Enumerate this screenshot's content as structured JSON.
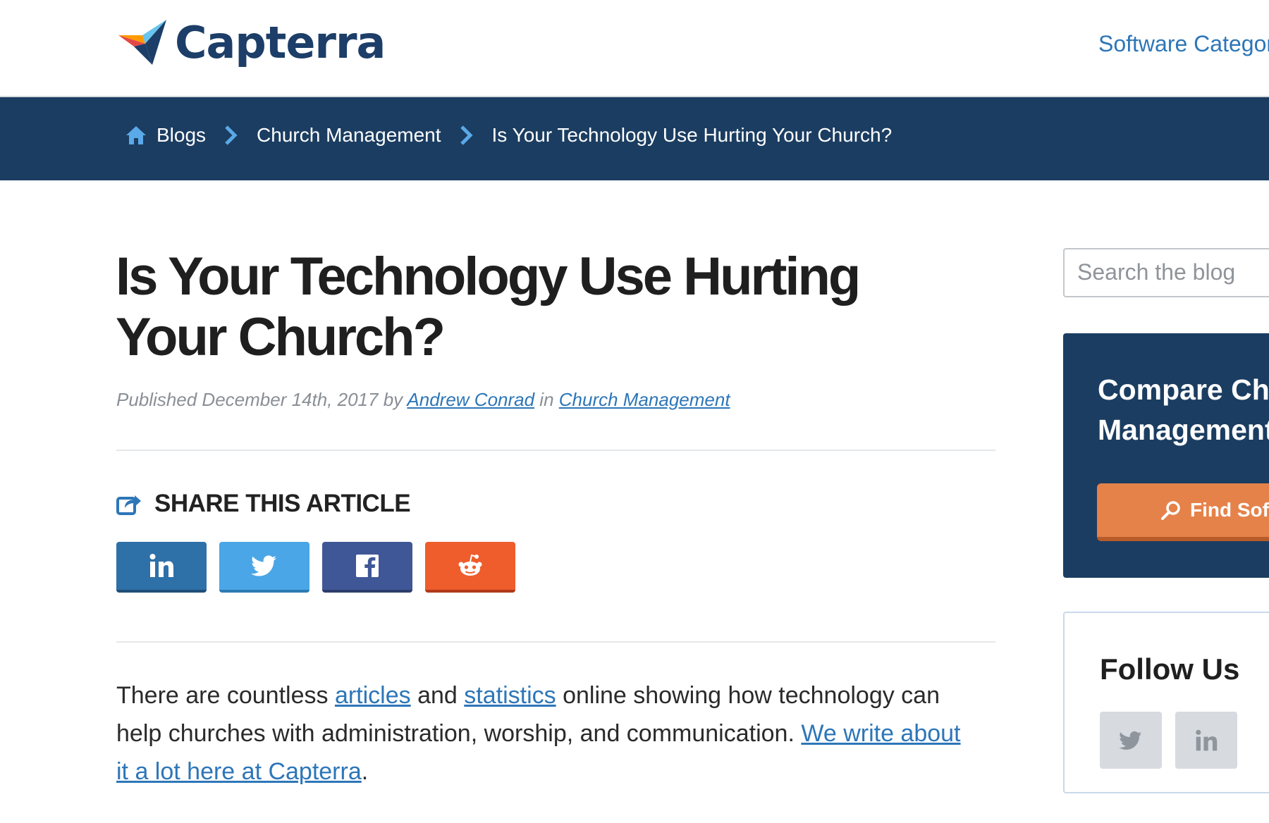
{
  "brand": {
    "name": "Capterra"
  },
  "nav": {
    "software_categories": "Software Categor"
  },
  "breadcrumb": {
    "items": [
      {
        "label": "Blogs"
      },
      {
        "label": "Church Management"
      },
      {
        "label": "Is Your Technology Use Hurting Your Church?"
      }
    ]
  },
  "article": {
    "title": "Is Your Technology Use Hurting Your Church?",
    "meta": {
      "published_prefix": "Published December 14th, 2017 by ",
      "author": "Andrew Conrad",
      "in_text": " in ",
      "category": "Church Management"
    },
    "share": {
      "heading": "SHARE THIS ARTICLE",
      "buttons": [
        {
          "name": "linkedin",
          "icon": "linkedin-icon",
          "color": "#2e70a8"
        },
        {
          "name": "twitter",
          "icon": "twitter-icon",
          "color": "#4aa6e6"
        },
        {
          "name": "facebook",
          "icon": "facebook-icon",
          "color": "#3f5797"
        },
        {
          "name": "reddit",
          "icon": "reddit-icon",
          "color": "#ee5d2b"
        }
      ]
    },
    "body": {
      "p1_text1": "There are countless ",
      "p1_link1": "articles",
      "p1_text2": " and ",
      "p1_link2": "statistics",
      "p1_text3": " online showing how technology can help churches with administration, worship, and communication. ",
      "p1_link3": "We write about it a lot here at Capterra",
      "p1_text4": "."
    }
  },
  "sidebar": {
    "search": {
      "placeholder": "Search the blog"
    },
    "compare": {
      "title": "Compare Chu\nManagement",
      "button": "Find Soft"
    },
    "follow": {
      "title": "Follow Us",
      "icons": [
        "twitter-icon",
        "linkedin-icon"
      ]
    }
  },
  "colors": {
    "brand_navy": "#1b3d61",
    "link_blue": "#2d76b8",
    "cta_orange": "#e5824a"
  }
}
